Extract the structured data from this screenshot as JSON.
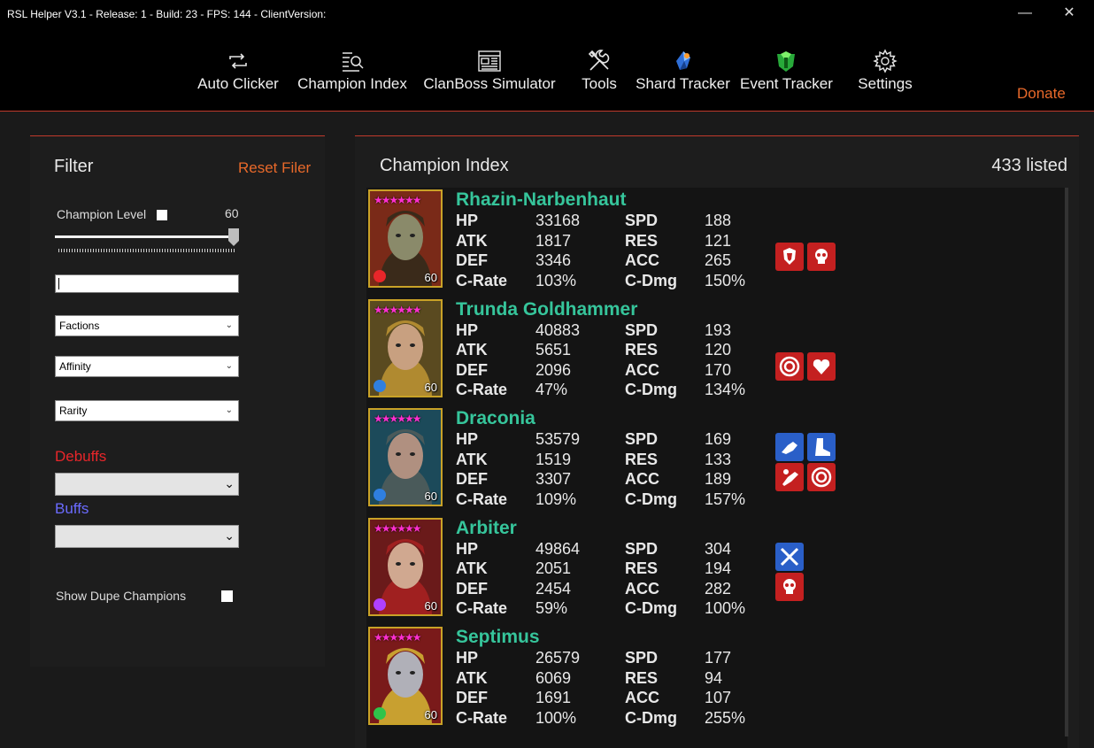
{
  "window": {
    "title": "RSL Helper V3.1 - Release: 1 - Build: 23 - FPS: 144 - ClientVersion:",
    "minimize": "—",
    "close": "✕"
  },
  "nav": {
    "items": [
      {
        "label": "Auto Clicker",
        "icon": "repeat-icon"
      },
      {
        "label": "Champion Index",
        "icon": "list-search-icon"
      },
      {
        "label": "ClanBoss Simulator",
        "icon": "newspaper-icon"
      },
      {
        "label": "Tools",
        "icon": "tools-icon"
      },
      {
        "label": "Shard Tracker",
        "icon": "shard-icon"
      },
      {
        "label": "Event Tracker",
        "icon": "event-icon"
      },
      {
        "label": "Settings",
        "icon": "gear-icon"
      }
    ],
    "donate": "Donate"
  },
  "filter": {
    "title": "Filter",
    "reset": "Reset Filer",
    "champion_level_label": "Champion Level",
    "champion_level_value": "60",
    "factions": "Factions",
    "affinity": "Affinity",
    "rarity": "Rarity",
    "debuffs_label": "Debuffs",
    "buffs_label": "Buffs",
    "show_dupes": "Show Dupe Champions"
  },
  "index": {
    "title": "Champion Index",
    "listed": "433 listed"
  },
  "stat_labels": {
    "hp": "HP",
    "atk": "ATK",
    "def": "DEF",
    "crate": "C-Rate",
    "spd": "SPD",
    "res": "RES",
    "acc": "ACC",
    "cdmg": "C-Dmg"
  },
  "champions": [
    {
      "name": "Rhazin-Narbenhaut",
      "level": "60",
      "stars": "★★★★★★",
      "hp": "33168",
      "atk": "1817",
      "def": "3346",
      "crate": "103%",
      "spd": "188",
      "res": "121",
      "acc": "265",
      "cdmg": "150%",
      "affinity_color": "#e8262a"
    },
    {
      "name": "Trunda Goldhammer",
      "level": "60",
      "stars": "★★★★★★",
      "hp": "40883",
      "atk": "5651",
      "def": "2096",
      "crate": "47%",
      "spd": "193",
      "res": "120",
      "acc": "170",
      "cdmg": "134%",
      "affinity_color": "#2f7fe0"
    },
    {
      "name": "Draconia",
      "level": "60",
      "stars": "★★★★★★",
      "hp": "53579",
      "atk": "1519",
      "def": "3307",
      "crate": "109%",
      "spd": "169",
      "res": "133",
      "acc": "189",
      "cdmg": "157%",
      "affinity_color": "#2f7fe0"
    },
    {
      "name": "Arbiter",
      "level": "60",
      "stars": "★★★★★★",
      "hp": "49864",
      "atk": "2051",
      "def": "2454",
      "crate": "59%",
      "spd": "304",
      "res": "194",
      "acc": "282",
      "cdmg": "100%",
      "affinity_color": "#b040ff"
    },
    {
      "name": "Septimus",
      "level": "60",
      "stars": "★★★★★★",
      "hp": "26579",
      "atk": "6069",
      "def": "1691",
      "crate": "100%",
      "spd": "177",
      "res": "94",
      "acc": "107",
      "cdmg": "255%",
      "affinity_color": "#2fc44a"
    }
  ]
}
